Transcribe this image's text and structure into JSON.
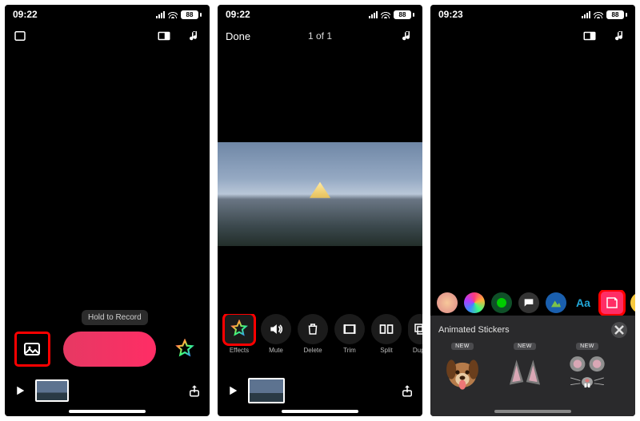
{
  "screens": [
    {
      "status": {
        "time": "09:22",
        "battery": "88"
      },
      "nav": {},
      "tooltip": "Hold to Record"
    },
    {
      "status": {
        "time": "09:22",
        "battery": "88"
      },
      "nav": {
        "done": "Done",
        "counter": "1 of 1"
      },
      "tools": [
        {
          "label": "Effects"
        },
        {
          "label": "Mute"
        },
        {
          "label": "Delete"
        },
        {
          "label": "Trim"
        },
        {
          "label": "Split"
        },
        {
          "label": "Dupli"
        }
      ]
    },
    {
      "status": {
        "time": "09:23",
        "battery": "88"
      },
      "nav": {},
      "text_category": "Aa",
      "drawer": {
        "title": "Animated Stickers",
        "stickers": [
          {
            "badge": "NEW",
            "name": "dog"
          },
          {
            "badge": "NEW",
            "name": "cat-ears"
          },
          {
            "badge": "NEW",
            "name": "mouse"
          }
        ]
      }
    }
  ]
}
